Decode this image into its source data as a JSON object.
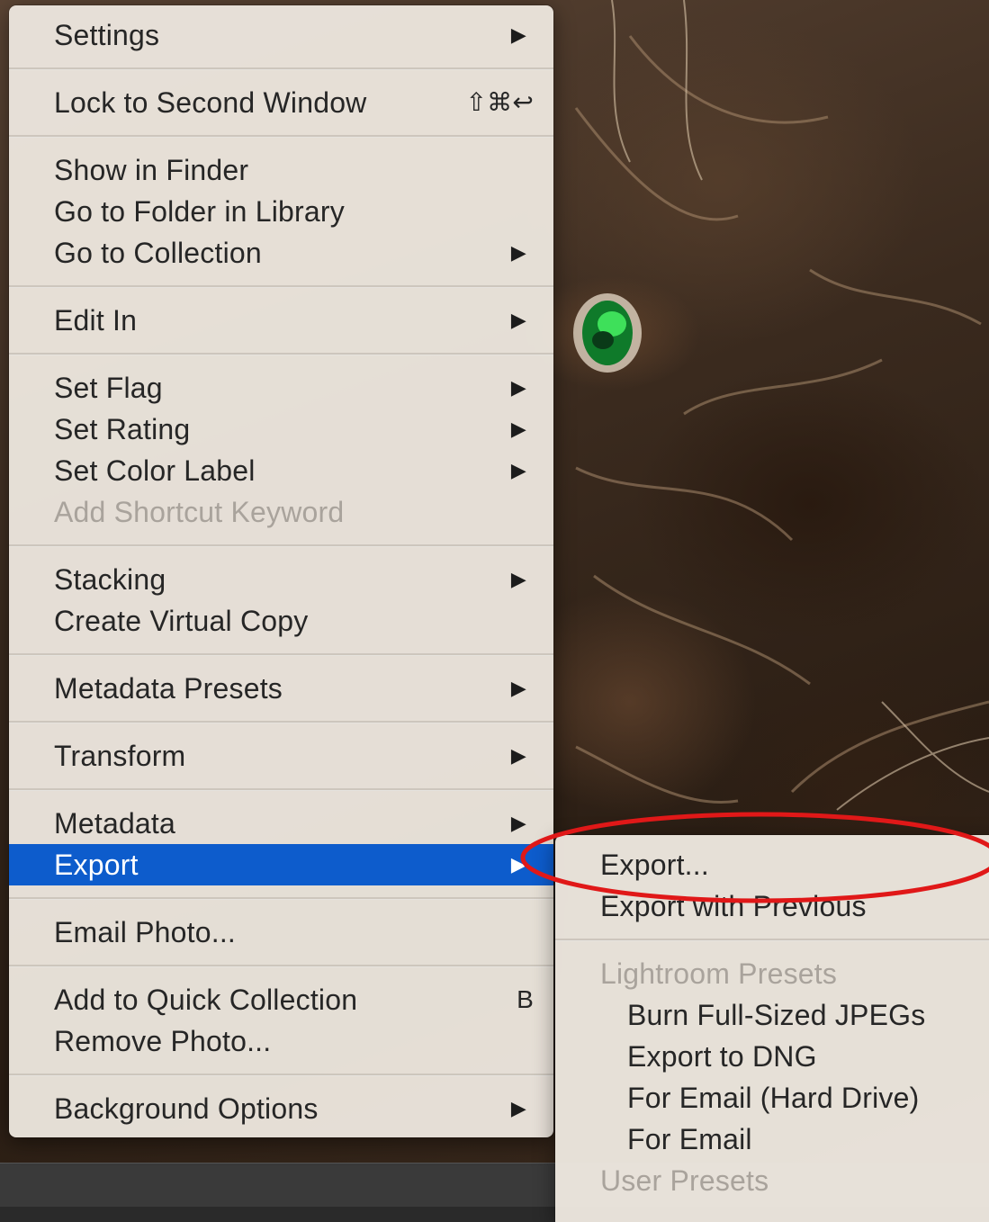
{
  "menu": {
    "groups": [
      [
        {
          "label": "Settings",
          "submenu": true
        }
      ],
      [
        {
          "label": "Lock to Second Window",
          "shortcut": "⇧⌘↩"
        }
      ],
      [
        {
          "label": "Show in Finder"
        },
        {
          "label": "Go to Folder in Library"
        },
        {
          "label": "Go to Collection",
          "submenu": true
        }
      ],
      [
        {
          "label": "Edit In",
          "submenu": true
        }
      ],
      [
        {
          "label": "Set Flag",
          "submenu": true
        },
        {
          "label": "Set Rating",
          "submenu": true
        },
        {
          "label": "Set Color Label",
          "submenu": true
        },
        {
          "label": "Add Shortcut Keyword",
          "disabled": true
        }
      ],
      [
        {
          "label": "Stacking",
          "submenu": true
        },
        {
          "label": "Create Virtual Copy"
        }
      ],
      [
        {
          "label": "Metadata Presets",
          "submenu": true
        }
      ],
      [
        {
          "label": "Transform",
          "submenu": true
        }
      ],
      [
        {
          "label": "Metadata",
          "submenu": true
        },
        {
          "label": "Export",
          "submenu": true,
          "selected": true
        }
      ],
      [
        {
          "label": "Email Photo..."
        }
      ],
      [
        {
          "label": "Add to Quick Collection",
          "shortcut": "B"
        },
        {
          "label": "Remove Photo..."
        }
      ],
      [
        {
          "label": "Background Options",
          "submenu": true
        }
      ]
    ],
    "arrow_glyph": "▶"
  },
  "submenu": {
    "items": [
      {
        "label": "Export..."
      },
      {
        "label": "Export with Previous"
      }
    ],
    "presets_header": "Lightroom Presets",
    "presets": [
      "Burn Full-Sized JPEGs",
      "Export to DNG",
      "For Email (Hard Drive)",
      "For Email"
    ],
    "user_presets_header": "User Presets"
  },
  "colors": {
    "selection": "#0d5ccc",
    "annotation": "#e01818",
    "menu_bg": "#ece6de"
  }
}
